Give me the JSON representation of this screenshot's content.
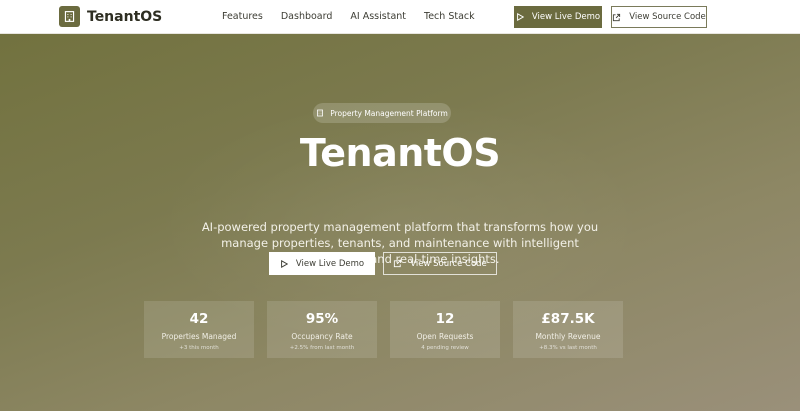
{
  "brand": {
    "name": "TenantOS",
    "logo_icon": "building-icon",
    "logo_color": "#6b6b3f"
  },
  "nav": {
    "links": [
      "Features",
      "Dashboard",
      "AI Assistant",
      "Tech Stack"
    ],
    "live_demo_label": "View Live Demo",
    "source_code_label": "View Source Code"
  },
  "hero": {
    "badge": "Property Management Platform",
    "badge_icon": "building-icon",
    "title": "TenantOS",
    "description": "AI-powered property management platform that transforms how you manage properties, tenants, and maintenance with intelligent automation and real-time insights.",
    "live_demo_label": "View Live Demo",
    "live_demo_icon": "play-icon",
    "source_code_label": "View Source Code",
    "source_code_icon": "external-link-icon"
  },
  "stats": [
    {
      "value": "42",
      "label": "Properties Managed",
      "sub": "+3 this month"
    },
    {
      "value": "95%",
      "label": "Occupancy Rate",
      "sub": "+2.5% from last month"
    },
    {
      "value": "12",
      "label": "Open Requests",
      "sub": "4 pending review"
    },
    {
      "value": "£87.5K",
      "label": "Monthly Revenue",
      "sub": "+8.3% vs last month"
    }
  ],
  "colors": {
    "accent": "#6b6b3f",
    "hero_start": "#72723f",
    "hero_end": "#9a907a"
  }
}
